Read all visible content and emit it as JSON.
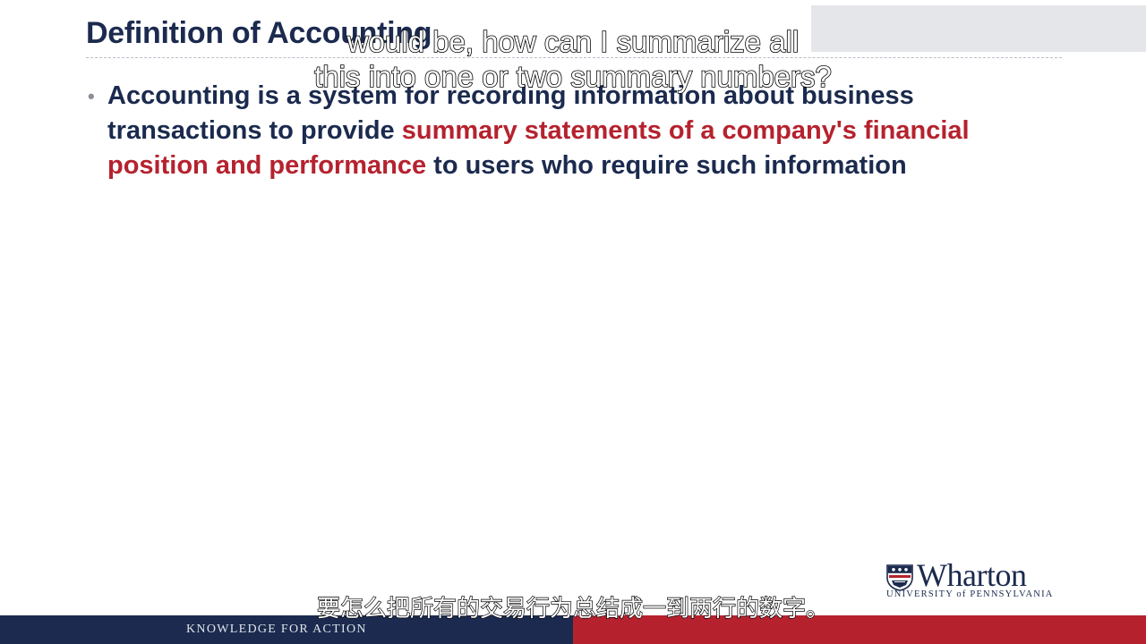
{
  "slide": {
    "title": "Definition of Accounting",
    "bullets": [
      {
        "text_before": "Accounting is a system for recording information about business transactions to provide ",
        "emphasis": "summary statements of a company's financial position and performance",
        "text_after": " to users who require such information"
      }
    ]
  },
  "logo": {
    "wordmark": "Wharton",
    "subline": "UNIVERSITY of PENNSYLVANIA"
  },
  "footer": {
    "tagline": "KNOWLEDGE FOR ACTION"
  },
  "captions": {
    "english_line_1": "would be, how can I summarize all",
    "english_line_2": "this into one or two summary numbers?",
    "chinese": "要怎么把所有的交易行为总结成一到两行的数字。"
  },
  "colors": {
    "navy": "#1b2a4e",
    "emphasis_red": "#b5222e",
    "footer_red": "#b5222e",
    "background": "#ffffff"
  }
}
